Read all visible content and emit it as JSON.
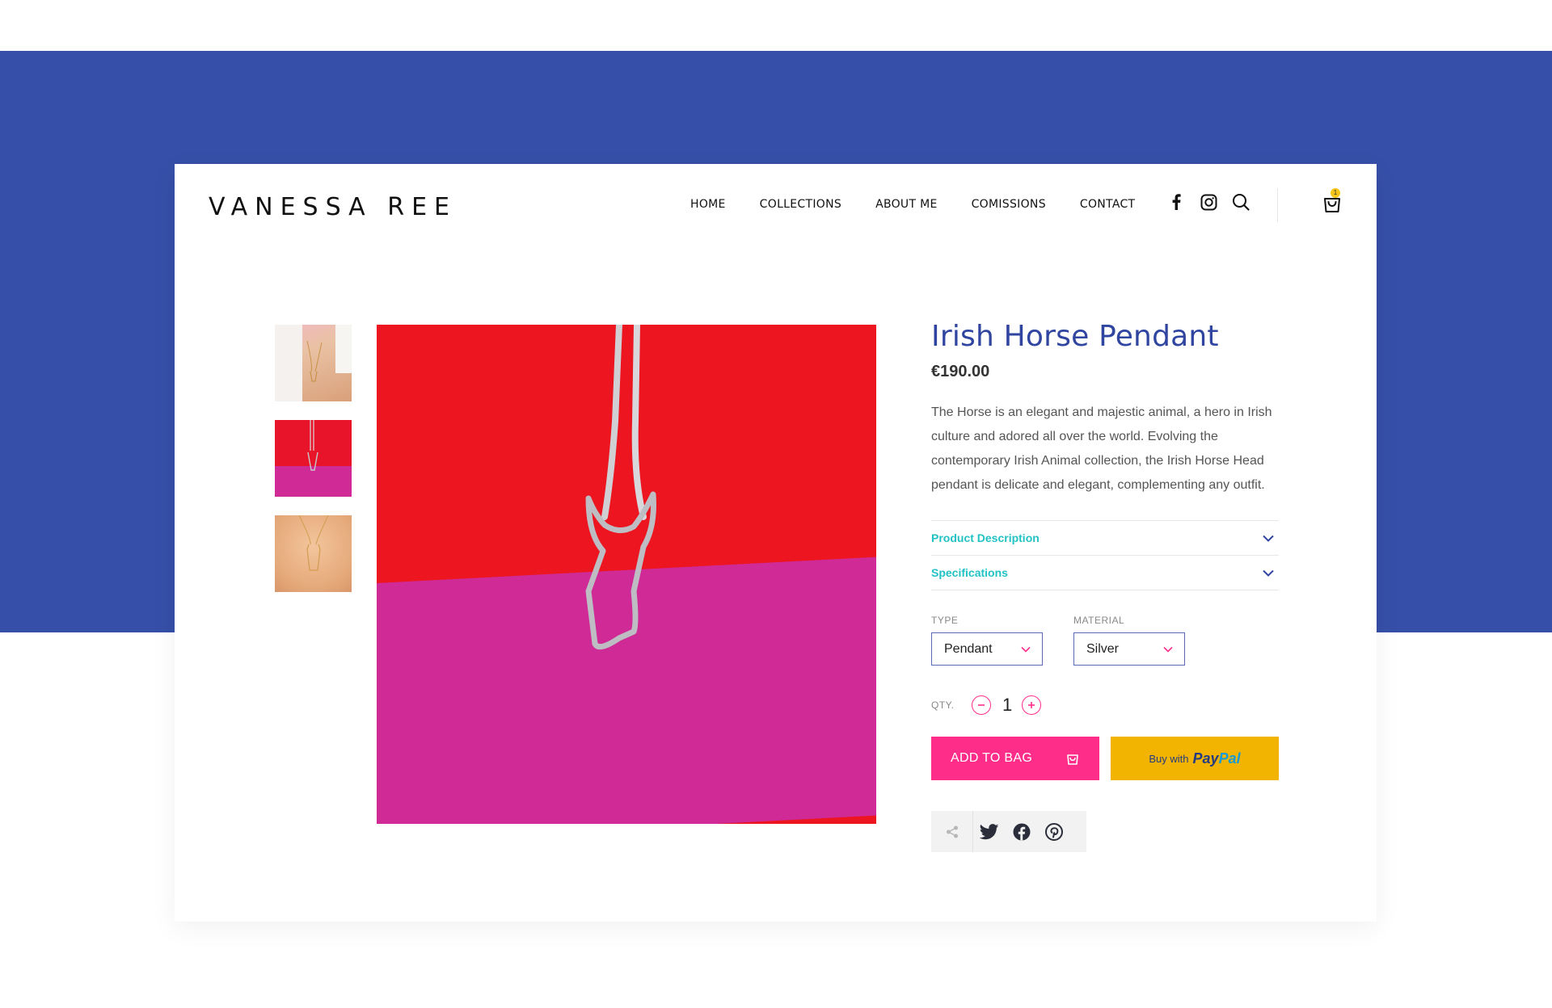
{
  "brand": {
    "logo_text": "VANESSA REE"
  },
  "nav": {
    "items": [
      "HOME",
      "COLLECTIONS",
      "ABOUT ME",
      "COMISSIONS",
      "CONTACT"
    ]
  },
  "header_icons": [
    "facebook-icon",
    "instagram-icon",
    "search-icon",
    "shopping-bag-icon"
  ],
  "cart": {
    "badge": "1"
  },
  "gallery": {
    "thumbnails": [
      "thumbnail-model-wearing",
      "thumbnail-pendant-red",
      "thumbnail-pendant-skin"
    ],
    "selected_index": 1
  },
  "product": {
    "title": "Irish Horse Pendant",
    "price": "€190.00",
    "description": "The Horse is an elegant and majestic animal, a hero in Irish culture and adored all over the world. Evolving the contemporary Irish Animal collection, the Irish Horse Head pendant is delicate and elegant, complementing any outfit."
  },
  "accordion": {
    "product_description": "Product Description",
    "specifications": "Specifications"
  },
  "options": {
    "type_label": "TYPE",
    "type_value": "Pendant",
    "material_label": "MATERIAL",
    "material_value": "Silver"
  },
  "quantity": {
    "label": "QTY.",
    "value": "1"
  },
  "buttons": {
    "add_to_bag": "ADD TO BAG",
    "paypal_prefix": "Buy with",
    "paypal_brand_1": "Pay",
    "paypal_brand_2": "Pal"
  },
  "share": [
    "share-icon",
    "twitter-icon",
    "facebook-icon",
    "pinterest-icon"
  ],
  "colors": {
    "band": "#364fa8",
    "title": "#2f45a0",
    "accent_pink": "#ff2d8a",
    "accordion_teal": "#22c2c4",
    "paypal_yellow": "#f2b400"
  }
}
